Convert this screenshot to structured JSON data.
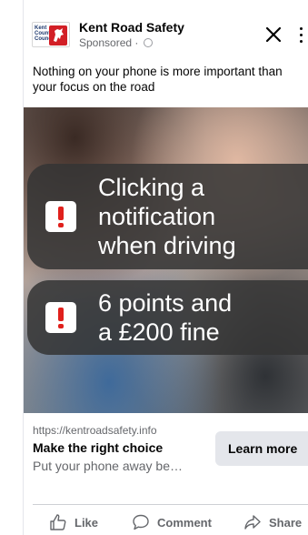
{
  "post": {
    "page_name": "Kent Road Safety",
    "sponsored_label": "Sponsored",
    "logo_text": "Kent County Council",
    "caption": "Nothing on your phone is more important than your focus on the road"
  },
  "creative": {
    "banners": [
      {
        "lines": [
          "Clicking a",
          "notification",
          "when driving"
        ]
      },
      {
        "lines": [
          "6 points and",
          "a £200 fine"
        ]
      }
    ]
  },
  "link_preview": {
    "url": "https://kentroadsafety.info",
    "title": "Make the right choice",
    "description": "Put your phone away be…",
    "cta_label": "Learn more"
  },
  "actions": {
    "like": "Like",
    "comment": "Comment",
    "share": "Share"
  },
  "icons": {
    "close": "close-icon",
    "more": "more-icon",
    "globe": "globe-icon",
    "warning": "warning-icon",
    "like": "thumbs-up-icon",
    "comment": "comment-icon",
    "share": "share-icon"
  },
  "colors": {
    "banner_bg": "#343434",
    "warning_red": "#e0201c",
    "secondary_text": "#65676b",
    "cta_bg": "#e4e6eb"
  }
}
